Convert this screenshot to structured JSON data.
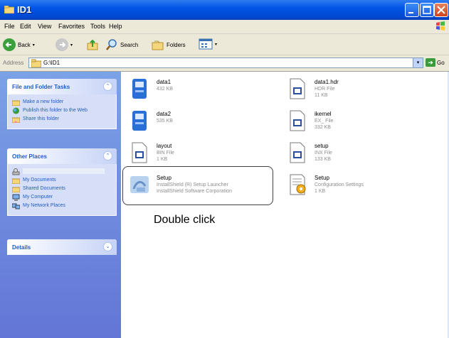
{
  "window": {
    "title": "ID1"
  },
  "menu": [
    "File",
    "Edit",
    "View",
    "Favorites",
    "Tools",
    "Help"
  ],
  "toolbar": {
    "back": "Back",
    "search": "Search",
    "folders": "Folders"
  },
  "address": {
    "label": "Address",
    "path": "G:\\ID1",
    "go": "Go"
  },
  "sidebar": {
    "file_tasks": {
      "title": "File and Folder Tasks",
      "items": [
        "Make a new folder",
        "Publish this folder to the Web",
        "Share this folder"
      ]
    },
    "other_places": {
      "title": "Other Places",
      "items": [
        "",
        "My Documents",
        "Shared Documents",
        "My Computer",
        "My Network Places"
      ]
    },
    "details": {
      "title": "Details"
    }
  },
  "files": [
    {
      "name": "data1",
      "meta1": "432 KB",
      "meta2": "",
      "icon": "cab-archive-icon"
    },
    {
      "name": "data1.hdr",
      "meta1": "HDR File",
      "meta2": "11 KB",
      "icon": "generic-file-icon"
    },
    {
      "name": "data2",
      "meta1": "535 KB",
      "meta2": "",
      "icon": "cab-archive-icon"
    },
    {
      "name": "ikernel",
      "meta1": "EX_ File",
      "meta2": "332 KB",
      "icon": "generic-file-icon"
    },
    {
      "name": "layout",
      "meta1": "BIN File",
      "meta2": "1 KB",
      "icon": "generic-file-icon"
    },
    {
      "name": "setup",
      "meta1": "INX File",
      "meta2": "133 KB",
      "icon": "generic-file-icon"
    },
    {
      "name": "Setup",
      "meta1": "InstallShield (R) Setup Launcher",
      "meta2": "InstallShield Software Corporation",
      "icon": "installer-icon"
    },
    {
      "name": "Setup",
      "meta1": "Configuration Settings",
      "meta2": "1 KB",
      "icon": "config-settings-icon"
    }
  ],
  "annotation": {
    "text": "Double click"
  }
}
